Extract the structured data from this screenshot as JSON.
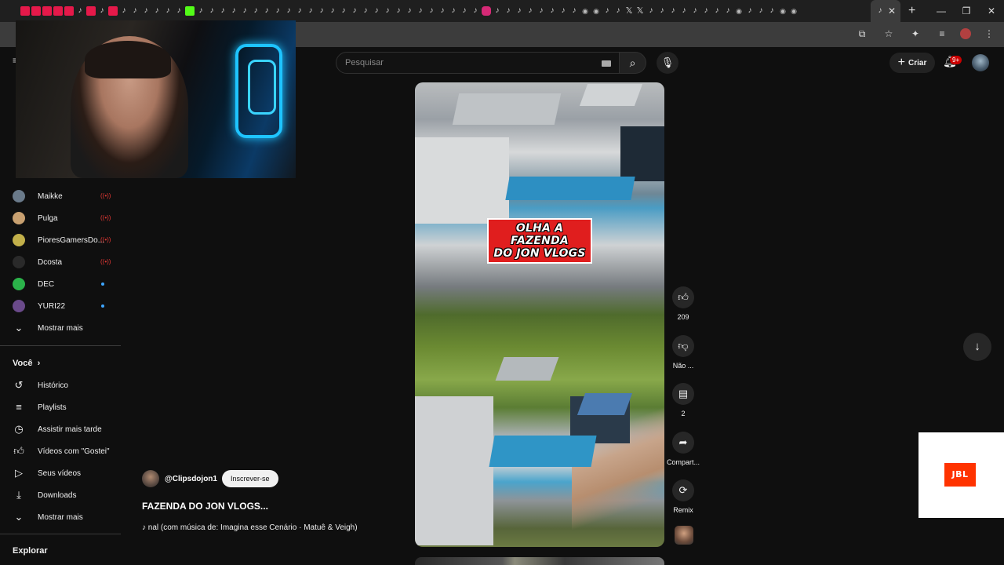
{
  "browser": {
    "tab_close": "✕",
    "new_tab": "+",
    "window_controls": [
      "—",
      "❐",
      "✕"
    ]
  },
  "header": {
    "search_placeholder": "Pesquisar",
    "create_label": "Criar",
    "notifications_badge": "9+"
  },
  "sidebar": {
    "subscriptions": [
      {
        "label": "Maikke",
        "status": "live",
        "color": "#6a7a8a"
      },
      {
        "label": "Pulga",
        "status": "live",
        "color": "#c8a070"
      },
      {
        "label": "PioresGamersDo...",
        "status": "live",
        "color": "#c2b04a"
      },
      {
        "label": "Dcosta",
        "status": "live",
        "color": "#2a2a2a"
      },
      {
        "label": "DEC",
        "status": "new",
        "color": "#2bb34a"
      },
      {
        "label": "YURI22",
        "status": "new",
        "color": "#6a4a8a"
      }
    ],
    "show_more_subs": "Mostrar mais",
    "you_section": "Você",
    "you_items": [
      {
        "label": "Histórico",
        "icon": "history-icon"
      },
      {
        "label": "Playlists",
        "icon": "playlists-icon"
      },
      {
        "label": "Assistir mais tarde",
        "icon": "watch-later-icon"
      },
      {
        "label": "Vídeos com \"Gostei\"",
        "icon": "liked-videos-icon"
      },
      {
        "label": "Seus vídeos",
        "icon": "your-videos-icon"
      },
      {
        "label": "Downloads",
        "icon": "downloads-icon"
      }
    ],
    "show_more_you": "Mostrar mais",
    "explore_section": "Explorar"
  },
  "short": {
    "overlay_line1": "OLHA A FAZENDA",
    "overlay_line2": "DO JON VLOGS",
    "channel_handle": "@Clipsdojon1",
    "subscribe_label": "Inscrever-se",
    "title": "FAZENDA DO JON VLOGS...",
    "music": "♪ nal (com música de: Imagina esse Cenário · Matuê & Veigh)"
  },
  "actions": {
    "likes": "209",
    "dislike_label": "Não ...",
    "comments": "2",
    "share_label": "Compart...",
    "remix_label": "Remix"
  },
  "ad": {
    "brand": "JBL"
  },
  "colors": {
    "accent_red": "#e5194a",
    "subscribe_bg": "#f1f1f1",
    "new_dot": "#3ea6ff"
  }
}
